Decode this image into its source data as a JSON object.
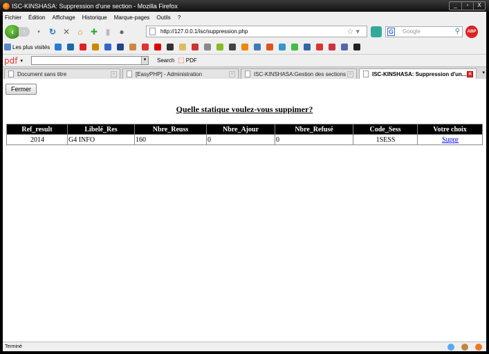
{
  "window": {
    "title": "ISC-KINSHASA: Suppression d'une section - Mozilla Firefox",
    "min": "_",
    "max": "▫",
    "close": "X"
  },
  "menu": [
    "Fichier",
    "Édition",
    "Affichage",
    "Historique",
    "Marque-pages",
    "Outils",
    "?"
  ],
  "nav": {
    "url": "http://127.0.0.1/isc/suppression.php",
    "search_placeholder": "Google",
    "abp": "ABP"
  },
  "bookmarks": {
    "most_visited": "Les plus visités",
    "icon_colors": [
      "#2a7ad8",
      "#1a6aa8",
      "#d22",
      "#c80",
      "#36c",
      "#248",
      "#c84",
      "#d33",
      "#d00",
      "#333",
      "#db6",
      "#c33",
      "#888",
      "#8b2",
      "#444",
      "#e80",
      "#47b",
      "#d52",
      "#39c",
      "#4b4",
      "#36a",
      "#d33",
      "#c34",
      "#56a",
      "#222"
    ]
  },
  "pdfbar": {
    "logo": "pdf",
    "search": "Search",
    "pdf": "PDF"
  },
  "tabs": [
    {
      "label": "Document sans titre"
    },
    {
      "label": "[EasyPHP] - Administration"
    },
    {
      "label": "ISC-KINSHASA:Gestion des sections"
    },
    {
      "label": "ISC-KINSHASA: Suppression d'un..."
    }
  ],
  "page": {
    "close_button": "Fermer",
    "heading": "Quelle statique voulez-vous suppimer?",
    "table": {
      "headers": [
        "Ref_result",
        "Libelé_Res",
        "Nbre_Reuss",
        "Nbre_Ajour",
        "Nbre_Refusé",
        "Code_Sess",
        "Votre choix"
      ],
      "rows": [
        [
          "2014",
          "G4 INFO",
          "160",
          "0",
          "0",
          "1SESS",
          "Suppr"
        ]
      ]
    }
  },
  "status": "Terminé"
}
